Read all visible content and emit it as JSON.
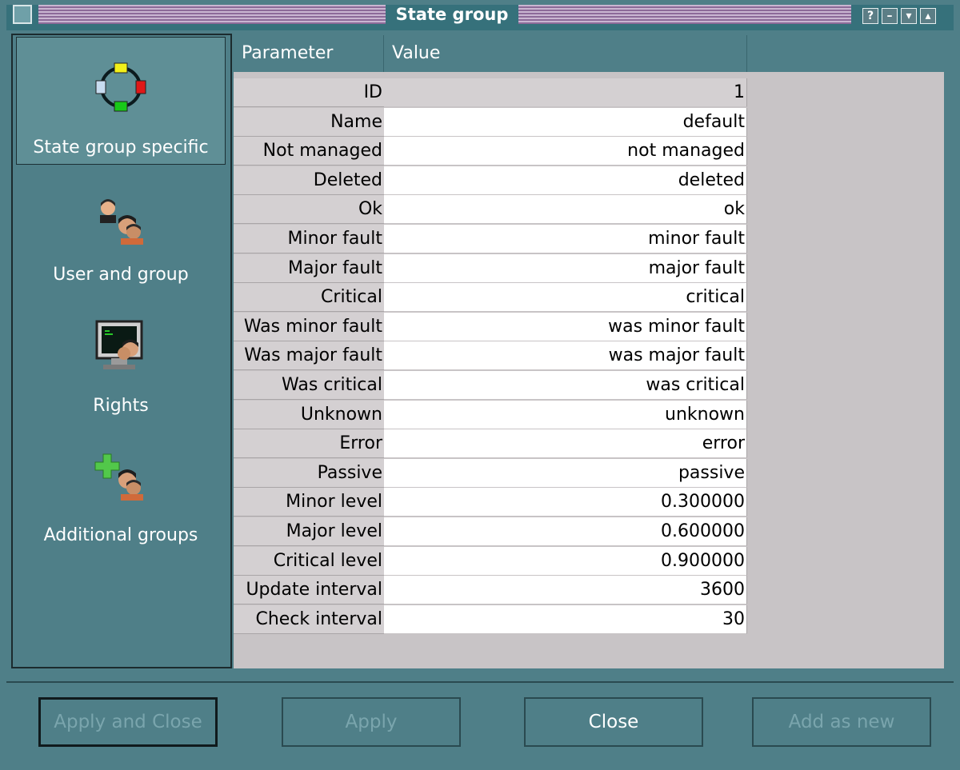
{
  "window": {
    "title": "State group"
  },
  "titlebar_buttons": [
    "?",
    "–",
    "▾",
    "▴"
  ],
  "sidebar": {
    "items": [
      {
        "label": "State group specific",
        "icon": "state-group-icon",
        "active": true
      },
      {
        "label": "User and group",
        "icon": "users-icon",
        "active": false
      },
      {
        "label": "Rights",
        "icon": "rights-icon",
        "active": false
      },
      {
        "label": "Additional groups",
        "icon": "add-group-icon",
        "active": false
      }
    ]
  },
  "table": {
    "headers": {
      "parameter": "Parameter",
      "value": "Value"
    },
    "rows": [
      {
        "param": "ID",
        "value": "1"
      },
      {
        "param": "Name",
        "value": "default"
      },
      {
        "param": "Not managed",
        "value": "not managed"
      },
      {
        "param": "Deleted",
        "value": "deleted"
      },
      {
        "param": "Ok",
        "value": "ok"
      },
      {
        "param": "Minor fault",
        "value": "minor fault"
      },
      {
        "param": "Major fault",
        "value": "major fault"
      },
      {
        "param": "Critical",
        "value": "critical"
      },
      {
        "param": "Was minor fault",
        "value": "was minor fault"
      },
      {
        "param": "Was major fault",
        "value": "was major fault"
      },
      {
        "param": "Was critical",
        "value": "was critical"
      },
      {
        "param": "Unknown",
        "value": "unknown"
      },
      {
        "param": "Error",
        "value": "error"
      },
      {
        "param": "Passive",
        "value": "passive"
      },
      {
        "param": "Minor level",
        "value": "0.300000"
      },
      {
        "param": "Major level",
        "value": "0.600000"
      },
      {
        "param": "Critical level",
        "value": "0.900000"
      },
      {
        "param": "Update interval",
        "value": "3600"
      },
      {
        "param": "Check interval",
        "value": "30"
      }
    ]
  },
  "buttons": {
    "apply_close": "Apply and Close",
    "apply": "Apply",
    "close": "Close",
    "add_new": "Add as new"
  },
  "colors": {
    "window_bg": "#4f7f88",
    "title_stripe_light": "#c9b6d1",
    "title_stripe_dark": "#8c6a98",
    "table_bg": "#c8c4c6"
  }
}
